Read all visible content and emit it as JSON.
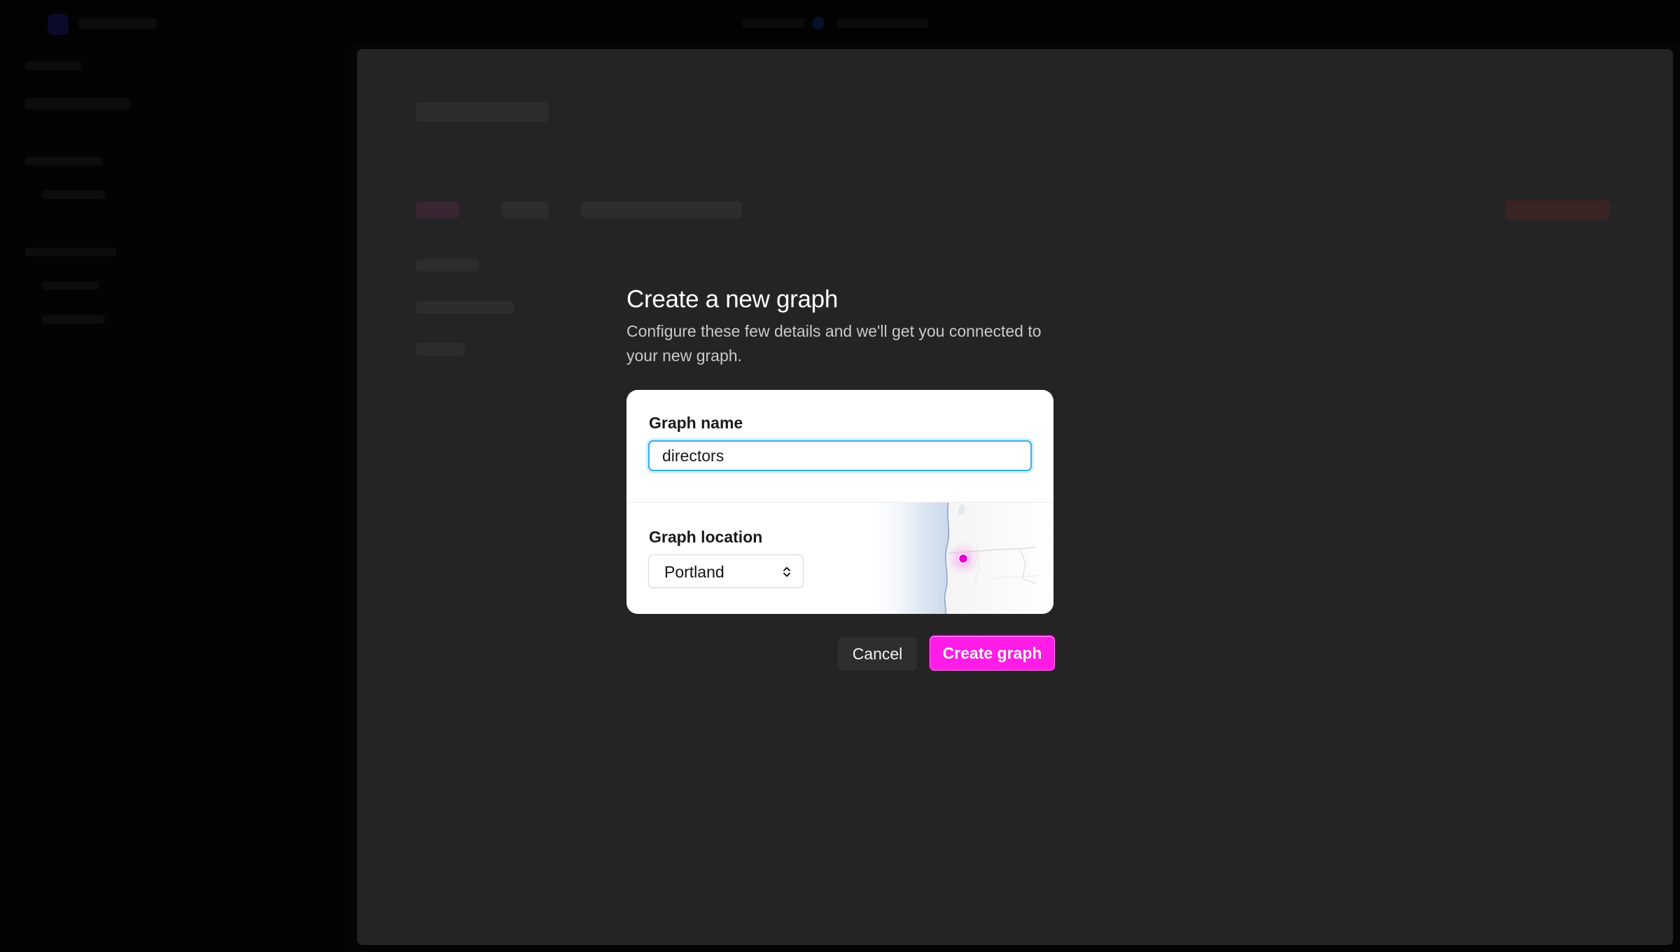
{
  "dialog": {
    "title": "Create a new graph",
    "subtitle": "Configure these few details and we'll get you connected to your new graph."
  },
  "form": {
    "name_label": "Graph name",
    "name_value": "directors",
    "location_label": "Graph location",
    "location_value": "Portland"
  },
  "actions": {
    "cancel_label": "Cancel",
    "create_label": "Create graph"
  },
  "icons": {
    "location_select": "chevron-up-down-icon",
    "map_marker": "location-pin-icon"
  },
  "colors": {
    "accent": "#ff1ce6",
    "focus_ring": "#3aaee6",
    "overlay": "#242424",
    "card": "#ffffff"
  }
}
